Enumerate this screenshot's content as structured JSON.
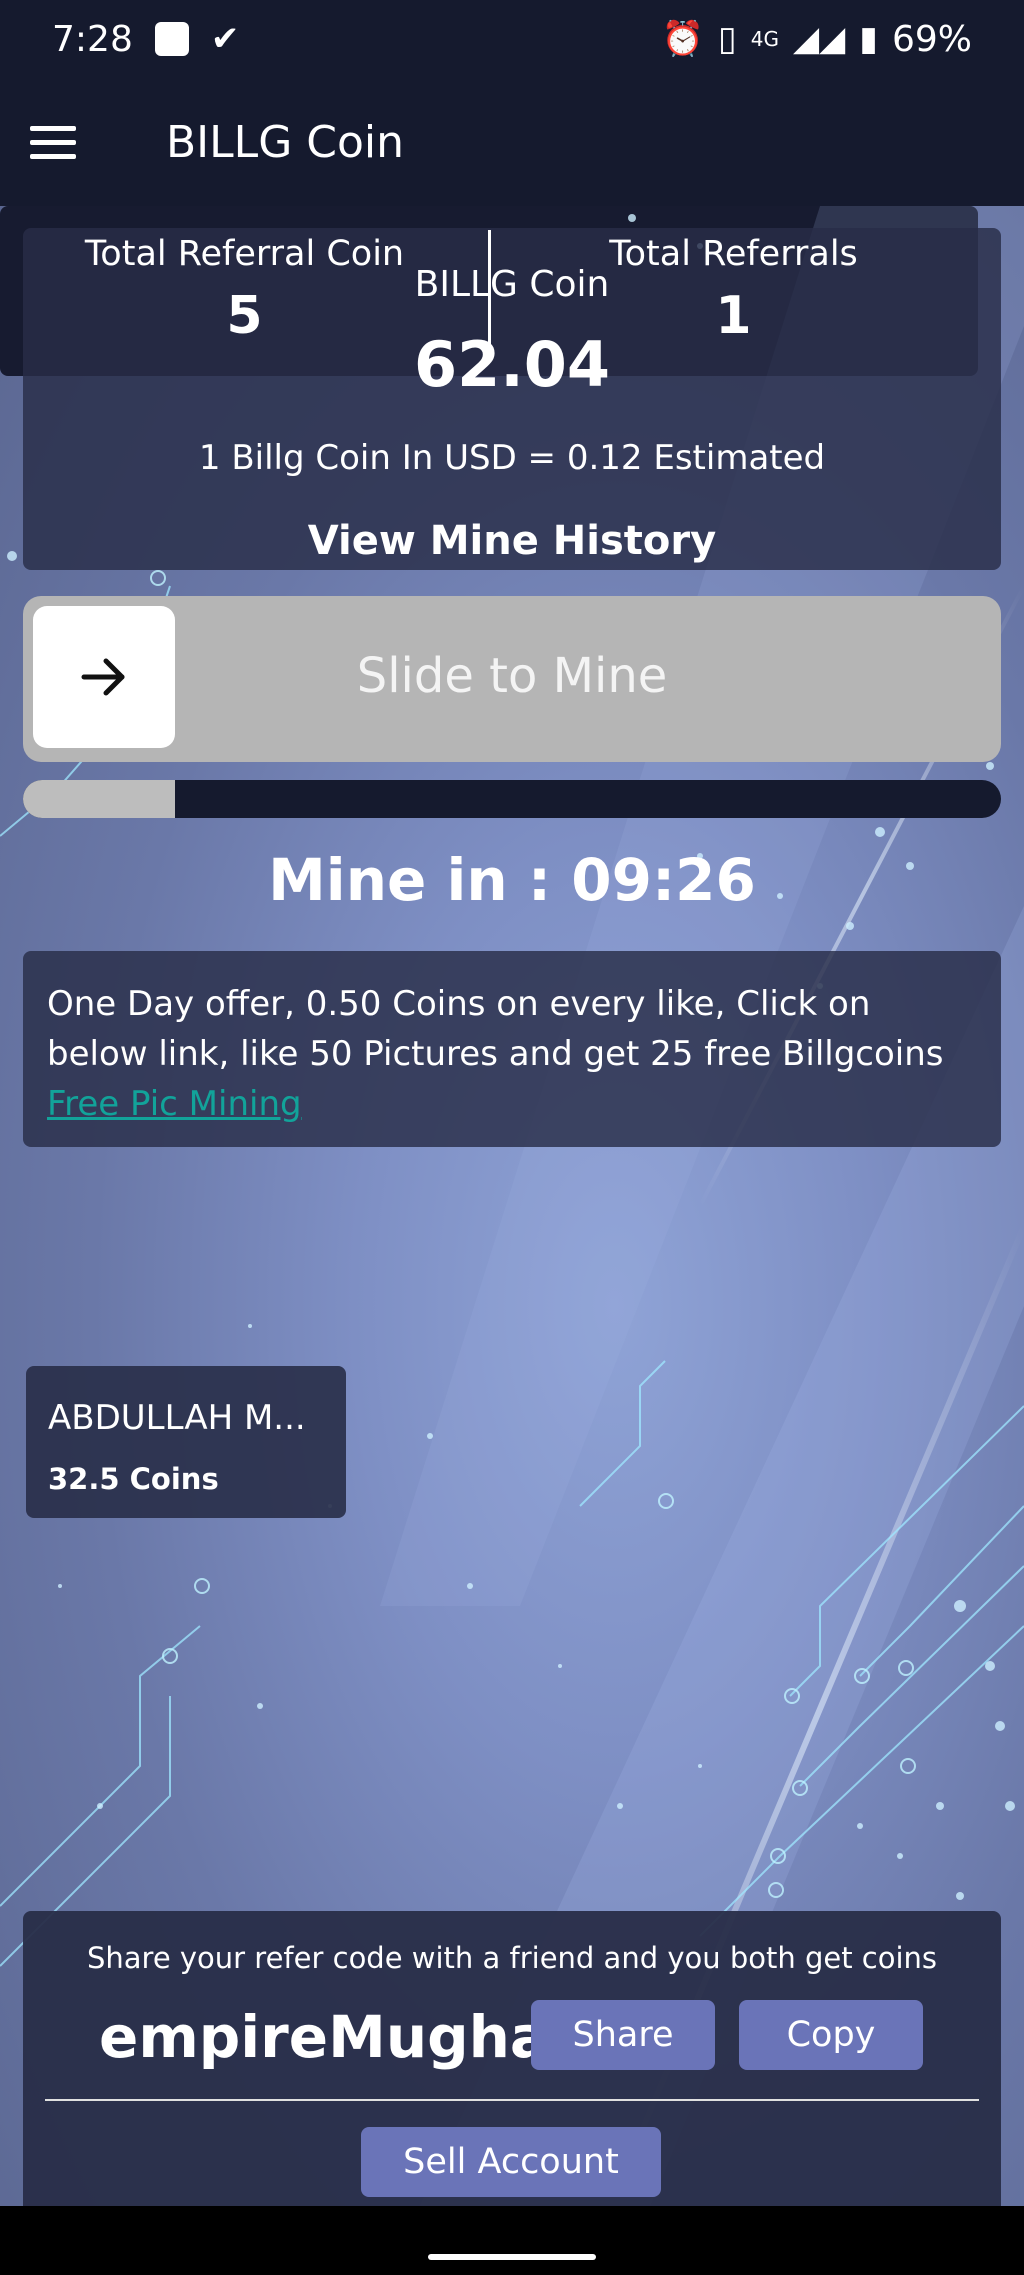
{
  "status_bar": {
    "time": "7:28",
    "network": "4G",
    "battery": "69%"
  },
  "app_bar": {
    "title": "BILLG Coin"
  },
  "balance": {
    "label": "BILLG Coin",
    "value": "62.04",
    "rate": "1 Billg Coin In USD = 0.12 Estimated",
    "history_link": "View Mine History"
  },
  "slider": {
    "label": "Slide to Mine",
    "knob_icon": "arrow-right-icon"
  },
  "progress": {
    "fraction": 0.155
  },
  "timer": {
    "text": "Mine in : 09:26"
  },
  "offer": {
    "text": "One Day offer, 0.50 Coins on every like, Click on below link, like 50 Pictures and get 25 free Billgcoins ",
    "link": "Free Pic Mining "
  },
  "referral_stats": {
    "coin_label": "Total Referral Coin",
    "coin_value": "5",
    "count_label": "Total Referrals",
    "count_value": "1"
  },
  "referrals": [
    {
      "name": "ABDULLAH M...",
      "coins": "32.5 Coins"
    }
  ],
  "share": {
    "text": "Share your refer code with a friend and you both get coins",
    "code": "empireMughal",
    "share_label": "Share",
    "copy_label": "Copy",
    "sell_label": "Sell Account"
  },
  "colors": {
    "header_bg": "#151a2e",
    "button_bg": "#6a74b8",
    "link": "#12a39a",
    "slider_bg": "#b5b5b5"
  }
}
